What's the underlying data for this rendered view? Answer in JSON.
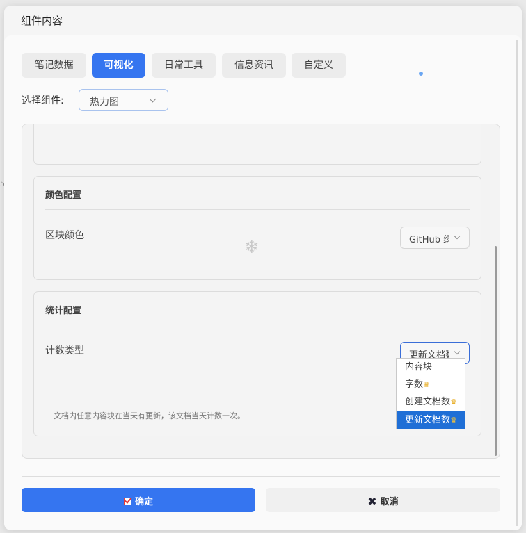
{
  "dialog": {
    "title": "组件内容"
  },
  "tabs": [
    {
      "label": "笔记数据",
      "active": false
    },
    {
      "label": "可视化",
      "active": true
    },
    {
      "label": "日常工具",
      "active": false
    },
    {
      "label": "信息资讯",
      "active": false
    },
    {
      "label": "自定义",
      "active": false
    }
  ],
  "component_select": {
    "label": "选择组件:",
    "value": "热力图"
  },
  "color_config": {
    "title": "颜色配置",
    "block_color_label": "区块颜色",
    "block_color_value": "GitHub 绿"
  },
  "stats_config": {
    "title": "统计配置",
    "count_type_label": "计数类型",
    "count_type_value": "更新文档数",
    "options": [
      {
        "label": "内容块",
        "premium": false,
        "selected": false
      },
      {
        "label": "字数",
        "premium": true,
        "selected": false
      },
      {
        "label": "创建文档数",
        "premium": true,
        "selected": false
      },
      {
        "label": "更新文档数",
        "premium": true,
        "selected": true
      }
    ],
    "note": "文档内任意内容块在当天有更新，该文档当天计数一次。"
  },
  "footer": {
    "confirm_label": "确定",
    "cancel_label": "取消"
  },
  "icons": {
    "premium": "crown-icon",
    "confirm": "checkbox-check-icon",
    "cancel": "close-x-icon",
    "decor": "snowflake-icon"
  },
  "colors": {
    "accent": "#3575f0",
    "selected_option": "#1f6fd6",
    "crown": "#e6a817"
  }
}
